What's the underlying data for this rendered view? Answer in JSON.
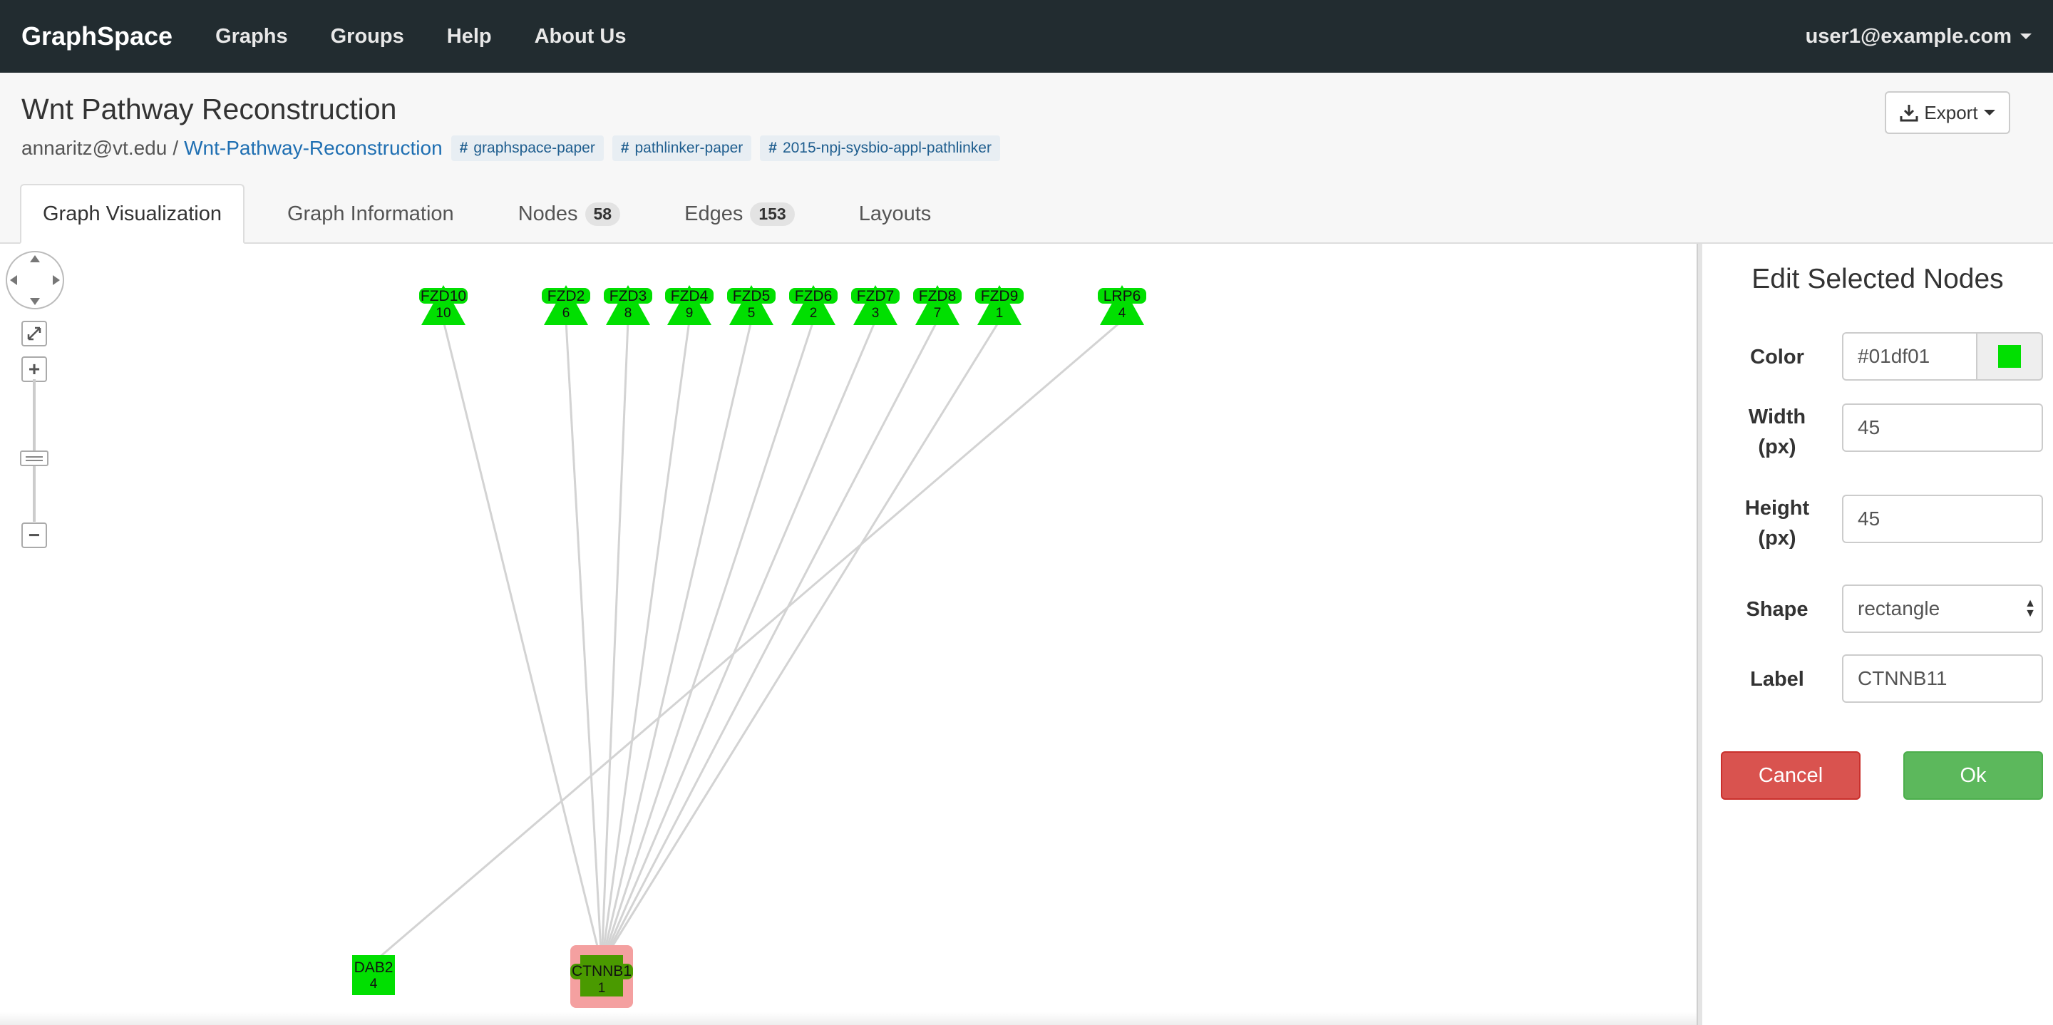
{
  "navbar": {
    "brand": "GraphSpace",
    "items": [
      {
        "label": "Graphs"
      },
      {
        "label": "Groups"
      },
      {
        "label": "Help"
      },
      {
        "label": "About Us"
      }
    ],
    "user": "user1@example.com"
  },
  "header": {
    "title": "Wnt Pathway Reconstruction",
    "owner": "annaritz@vt.edu",
    "separator": "/",
    "graph_name": "Wnt-Pathway-Reconstruction",
    "tags": [
      "graphspace-paper",
      "pathlinker-paper",
      "2015-npj-sysbio-appl-pathlinker"
    ],
    "export_label": "Export"
  },
  "tabs": [
    {
      "label": "Graph Visualization",
      "active": true
    },
    {
      "label": "Graph Information"
    },
    {
      "label": "Nodes",
      "badge": "58"
    },
    {
      "label": "Edges",
      "badge": "153"
    },
    {
      "label": "Layouts"
    }
  ],
  "graph": {
    "node_color": "#01df01",
    "selected_color": "#4a9a00",
    "selection_highlight": "#f4a0a0",
    "edge_color": "#d3d3d3",
    "top_nodes": [
      {
        "name": "FZD10",
        "num": "10"
      },
      {
        "name": "FZD2",
        "num": "6"
      },
      {
        "name": "FZD3",
        "num": "8"
      },
      {
        "name": "FZD4",
        "num": "9"
      },
      {
        "name": "FZD5",
        "num": "5"
      },
      {
        "name": "FZD6",
        "num": "2"
      },
      {
        "name": "FZD7",
        "num": "3"
      },
      {
        "name": "FZD8",
        "num": "7"
      },
      {
        "name": "FZD9",
        "num": "1"
      },
      {
        "name": "LRP6",
        "num": "4"
      }
    ],
    "dab2": {
      "name": "DAB2",
      "num": "4"
    },
    "ctnnb1": {
      "name": "CTNNB1",
      "num": "1"
    },
    "zoom_in": "+",
    "zoom_out": "−"
  },
  "editor": {
    "title": "Edit Selected Nodes",
    "color_label": "Color",
    "color_value": "#01df01",
    "width_label_1": "Width",
    "width_label_2": "(px)",
    "width_value": "45",
    "height_label_1": "Height",
    "height_label_2": "(px)",
    "height_value": "45",
    "shape_label": "Shape",
    "shape_value": "rectangle",
    "label_label": "Label",
    "label_value": "CTNNB11",
    "cancel": "Cancel",
    "ok": "Ok"
  }
}
